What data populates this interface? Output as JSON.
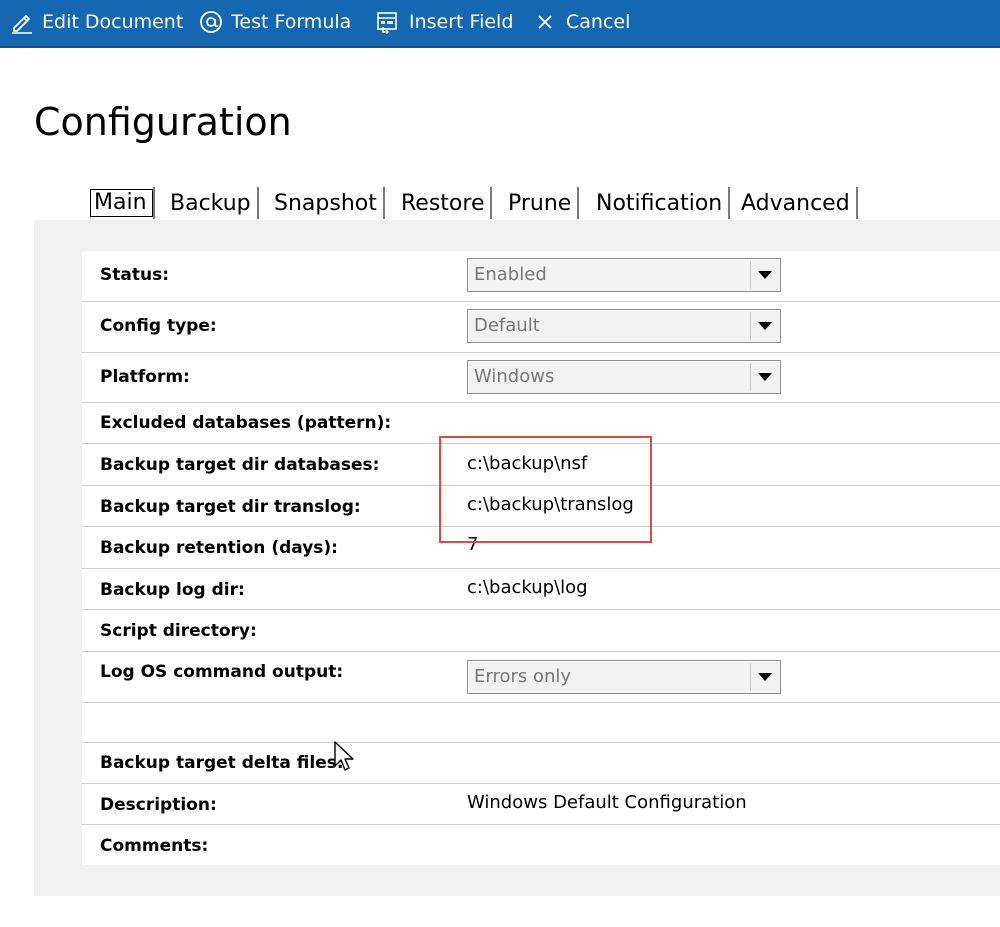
{
  "toolbar": {
    "edit_label": "Edit Document",
    "test_label": "Test Formula",
    "insert_label": "Insert Field",
    "cancel_label": "Cancel"
  },
  "page": {
    "title": "Configuration"
  },
  "tabs": [
    {
      "label": "Main",
      "active": true
    },
    {
      "label": "Backup"
    },
    {
      "label": "Snapshot"
    },
    {
      "label": "Restore"
    },
    {
      "label": "Prune"
    },
    {
      "label": "Notification"
    },
    {
      "label": "Advanced"
    }
  ],
  "form": {
    "status": {
      "label": "Status:",
      "value": "Enabled"
    },
    "config_type": {
      "label": "Config type:",
      "value": "Default"
    },
    "platform": {
      "label": "Platform:",
      "value": "Windows"
    },
    "excluded": {
      "label": "Excluded databases (pattern):",
      "value": ""
    },
    "target_db": {
      "label": "Backup target dir databases:",
      "value": "c:\\backup\\nsf"
    },
    "target_translog": {
      "label": "Backup target dir translog:",
      "value": "c:\\backup\\translog"
    },
    "retention": {
      "label": "Backup retention (days):",
      "value": "7"
    },
    "log_dir": {
      "label": "Backup log dir:",
      "value": "c:\\backup\\log"
    },
    "script_dir": {
      "label": "Script directory:",
      "value": ""
    },
    "log_os": {
      "label": "Log OS command output:",
      "value": "Errors only"
    },
    "delta_files": {
      "label": "Backup target delta files:",
      "value": ""
    },
    "description": {
      "label": "Description:",
      "value": "Windows Default Configuration"
    },
    "comments": {
      "label": "Comments:",
      "value": ""
    }
  },
  "colors": {
    "toolbar_bg": "#1667b2",
    "panel_bg": "#f0f0f0",
    "highlight": "#e0474c"
  },
  "icons": {
    "edit": "pencil-icon",
    "test": "at-sign-icon",
    "insert": "insert-field-icon",
    "cancel": "close-icon",
    "dropdown": "chevron-down-icon",
    "cursor": "mouse-pointer-icon"
  }
}
